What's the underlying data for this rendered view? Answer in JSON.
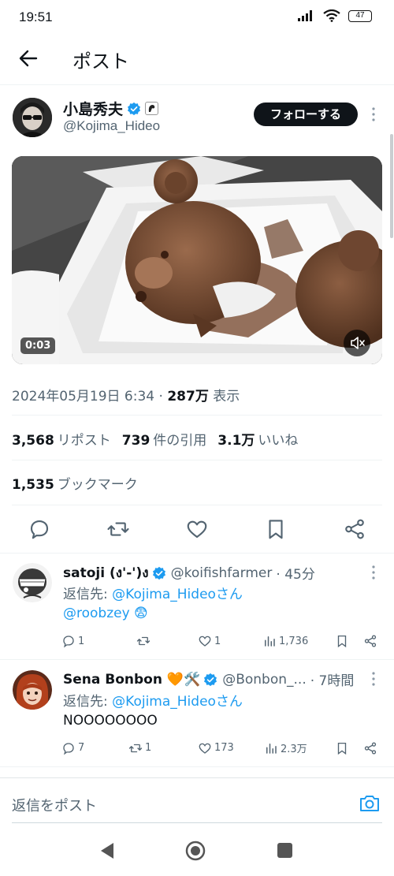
{
  "status_bar": {
    "time": "19:51",
    "battery": "47"
  },
  "header": {
    "title": "ポスト"
  },
  "post": {
    "author_name": "小島秀夫",
    "author_handle": "@Kojima_Hideo",
    "follow_label": "フォローする",
    "video_duration": "0:03",
    "datetime": "2024年05月19日 6:34",
    "views_count": "287万",
    "views_label": "表示",
    "reposts_count": "3,568",
    "reposts_label": "リポスト",
    "quotes_count": "739",
    "quotes_label": "件の引用",
    "likes_count": "3.1万",
    "likes_label": "いいね",
    "bookmarks_count": "1,535",
    "bookmarks_label": "ブックマーク"
  },
  "replies": [
    {
      "name": "satoji (ง'-')ง",
      "handle": "@koifishfarmer",
      "time": "· 45分",
      "reply_to_prefix": "返信先: ",
      "reply_to": "@Kojima_Hideoさん",
      "text": "@roobzey 😨",
      "replies": "1",
      "reposts": "",
      "likes": "1",
      "views": "1,736"
    },
    {
      "name": "Sena Bonbon 🧡🛠️",
      "handle": "@Bonbon_...",
      "time": "· 7時間",
      "reply_to_prefix": "返信先: ",
      "reply_to": "@Kojima_Hideoさん",
      "text": "NOOOOOOOO",
      "replies": "7",
      "reposts": "1",
      "likes": "173",
      "views": "2.3万"
    }
  ],
  "reply_bar": {
    "placeholder": "返信をポスト"
  },
  "colors": {
    "accent": "#1d9bf0",
    "text": "#0f1419",
    "secondary": "#536471",
    "follow_bg": "#0f1419"
  },
  "icons": [
    "back-arrow-icon",
    "verified-icon",
    "more-icon",
    "mute-icon",
    "reply-icon",
    "repost-icon",
    "like-icon",
    "bookmark-icon",
    "share-icon",
    "views-icon",
    "camera-icon"
  ]
}
